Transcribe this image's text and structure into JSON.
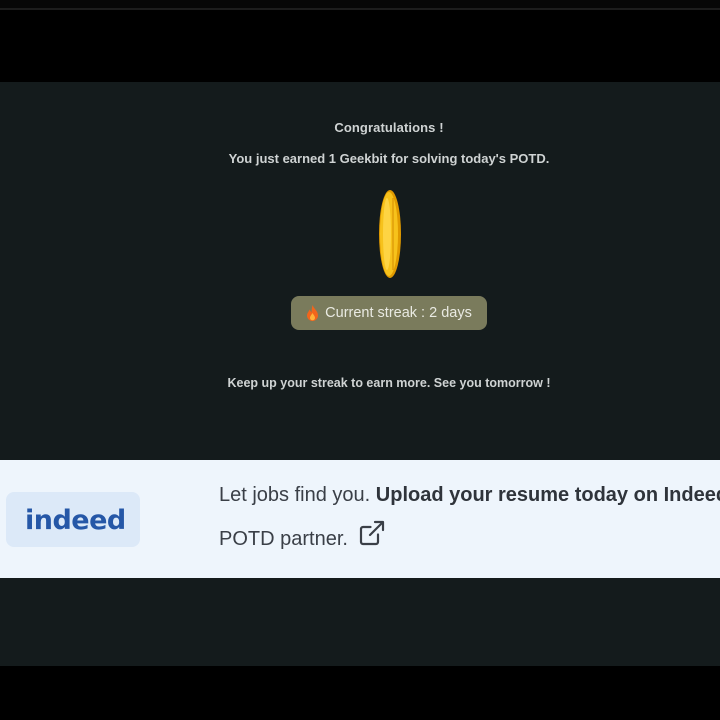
{
  "potd": {
    "congrats_title": "Congratulations !",
    "earned_message": "You just earned 1 Geekbit for solving today's POTD.",
    "coin_icon": "geekbit-coin-icon",
    "streak_icon": "fire-icon",
    "streak_label": "Current streak : 2 days",
    "keep_message": "Keep up your streak to earn more. See you tomorrow !",
    "colors": {
      "panel_bg": "#141b1c",
      "streak_pill": "#7a7b5c",
      "coin_gold": "#f5b800"
    }
  },
  "partner_banner": {
    "logo_text": "indeed",
    "text_plain": "Let jobs find you. ",
    "text_bold": "Upload your resume today on Indeed",
    "text_line2": "POTD partner.",
    "link_icon": "external-link-icon",
    "colors": {
      "banner_bg": "#eef5fc",
      "logo_blue": "#2557a7"
    }
  }
}
